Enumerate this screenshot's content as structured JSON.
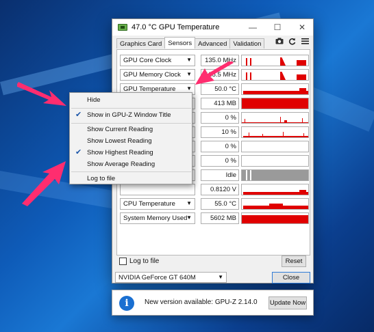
{
  "window": {
    "title": "47.0 °C GPU Temperature",
    "controls": {
      "minimize": "—",
      "maximize": "☐",
      "close": "✕"
    }
  },
  "tabs": [
    {
      "label": "Graphics Card",
      "active": false
    },
    {
      "label": "Sensors",
      "active": true
    },
    {
      "label": "Advanced",
      "active": false
    },
    {
      "label": "Validation",
      "active": false
    }
  ],
  "toolbar": {
    "camera_icon": "camera-icon",
    "refresh_icon": "refresh-icon",
    "menu_icon": "hamburger-menu-icon"
  },
  "sensors": [
    {
      "name": "GPU Core Clock",
      "value": "135.0 MHz"
    },
    {
      "name": "GPU Memory Clock",
      "value": "135.5 MHz"
    },
    {
      "name": "GPU Temperature",
      "value": "50.0 °C"
    },
    {
      "name": "",
      "value": "413 MB"
    },
    {
      "name": "",
      "value": "0 %"
    },
    {
      "name": "",
      "value": "10 %"
    },
    {
      "name": "",
      "value": "0 %"
    },
    {
      "name": "",
      "value": "0 %"
    },
    {
      "name": "",
      "value": "Idle"
    },
    {
      "name": "",
      "value": "0.8120 V"
    },
    {
      "name": "CPU Temperature",
      "value": "55.0 °C"
    },
    {
      "name": "System Memory Used",
      "value": "5602 MB"
    }
  ],
  "bottom": {
    "log_to_file": "Log to file",
    "reset": "Reset",
    "gpu_select": "NVIDIA GeForce GT 640M",
    "close": "Close"
  },
  "context_menu": {
    "items": [
      {
        "label": "Hide",
        "checked": false
      },
      {
        "label": "Show in GPU-Z Window Title",
        "checked": true
      },
      {
        "label": "Show Current Reading",
        "checked": false
      },
      {
        "label": "Show Lowest Reading",
        "checked": false
      },
      {
        "label": "Show Highest Reading",
        "checked": true
      },
      {
        "label": "Show Average Reading",
        "checked": false
      },
      {
        "label": "Log to file",
        "checked": false
      }
    ]
  },
  "update_notice": {
    "message": "New version available: GPU-Z 2.14.0",
    "button": "Update Now",
    "icon": "info-icon"
  },
  "colors": {
    "graph": "#e00000",
    "arrow": "#ff2d6f",
    "check": "#1a55a8"
  }
}
